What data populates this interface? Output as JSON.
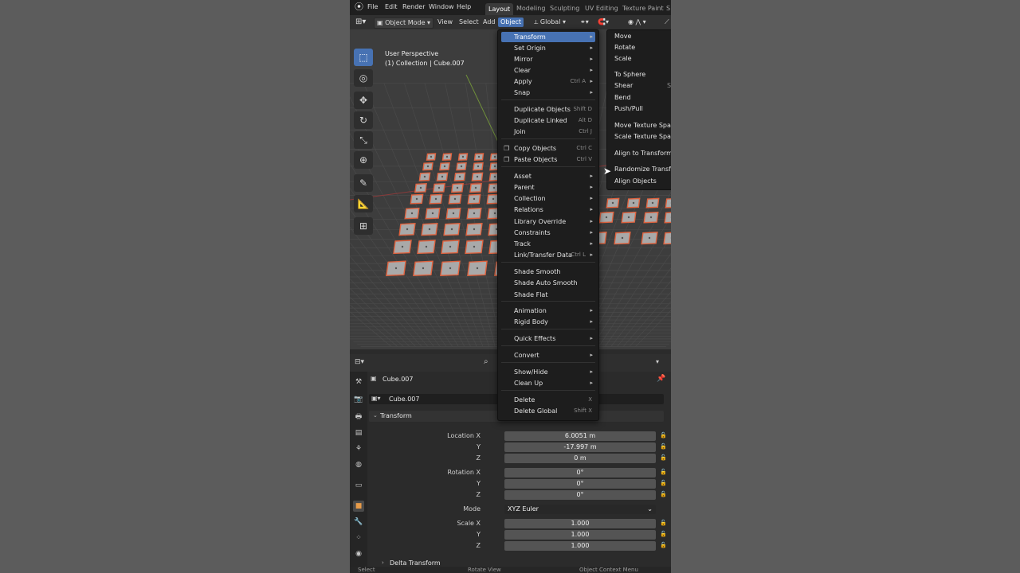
{
  "topbar": {
    "menus": [
      "File",
      "Edit",
      "Render",
      "Window",
      "Help"
    ],
    "workspaces": [
      "Layout",
      "Modeling",
      "Sculpting",
      "UV Editing",
      "Texture Paint",
      "S"
    ]
  },
  "header": {
    "mode": "Object Mode",
    "view": "View",
    "select": "Select",
    "add": "Add",
    "object": "Object",
    "orientation": "Global"
  },
  "viewport": {
    "perspective": "User Perspective",
    "collection": "(1) Collection | Cube.007"
  },
  "context_menu": {
    "items": [
      {
        "label": "Transform",
        "shortcut": "",
        "submenu": true,
        "highlight": true
      },
      {
        "label": "Set Origin",
        "shortcut": "",
        "submenu": true
      },
      {
        "label": "Mirror",
        "shortcut": "",
        "submenu": true
      },
      {
        "label": "Clear",
        "shortcut": "",
        "submenu": true
      },
      {
        "label": "Apply",
        "shortcut": "Ctrl A",
        "submenu": true
      },
      {
        "label": "Snap",
        "shortcut": "",
        "submenu": true
      },
      {
        "label": "Duplicate Objects",
        "shortcut": "Shift D",
        "submenu": false
      },
      {
        "label": "Duplicate Linked",
        "shortcut": "Alt D",
        "submenu": false
      },
      {
        "label": "Join",
        "shortcut": "Ctrl J",
        "submenu": false
      },
      {
        "label": "Copy Objects",
        "shortcut": "Ctrl C",
        "submenu": false
      },
      {
        "label": "Paste Objects",
        "shortcut": "Ctrl V",
        "submenu": false
      },
      {
        "label": "Asset",
        "shortcut": "",
        "submenu": true
      },
      {
        "label": "Parent",
        "shortcut": "",
        "submenu": true
      },
      {
        "label": "Collection",
        "shortcut": "",
        "submenu": true
      },
      {
        "label": "Relations",
        "shortcut": "",
        "submenu": true
      },
      {
        "label": "Library Override",
        "shortcut": "",
        "submenu": true
      },
      {
        "label": "Constraints",
        "shortcut": "",
        "submenu": true
      },
      {
        "label": "Track",
        "shortcut": "",
        "submenu": true
      },
      {
        "label": "Link/Transfer Data",
        "shortcut": "Ctrl L",
        "submenu": true
      },
      {
        "label": "Shade Smooth",
        "shortcut": "",
        "submenu": false
      },
      {
        "label": "Shade Auto Smooth",
        "shortcut": "",
        "submenu": false
      },
      {
        "label": "Shade Flat",
        "shortcut": "",
        "submenu": false
      },
      {
        "label": "Animation",
        "shortcut": "",
        "submenu": true
      },
      {
        "label": "Rigid Body",
        "shortcut": "",
        "submenu": true
      },
      {
        "label": "Quick Effects",
        "shortcut": "",
        "submenu": true
      },
      {
        "label": "Convert",
        "shortcut": "",
        "submenu": true
      },
      {
        "label": "Show/Hide",
        "shortcut": "",
        "submenu": true
      },
      {
        "label": "Clean Up",
        "shortcut": "",
        "submenu": true
      },
      {
        "label": "Delete",
        "shortcut": "X",
        "submenu": false
      },
      {
        "label": "Delete Global",
        "shortcut": "Shift X",
        "submenu": false
      }
    ]
  },
  "transform_submenu": {
    "items": [
      "Move",
      "Rotate",
      "Scale",
      "To Sphere",
      "Shear",
      "Bend",
      "Push/Pull",
      "Move Texture Space",
      "Scale Texture Space",
      "Align to Transform Ori",
      "Randomize Transform",
      "Align Objects"
    ],
    "shear_shortcut": "S"
  },
  "properties": {
    "object_name": "Cube.007",
    "data_name": "Cube.007",
    "panel_title": "Transform",
    "location": {
      "label": "Location X",
      "x": "6.0051 m",
      "y": "-17.997 m",
      "z": "0 m"
    },
    "rotation": {
      "label": "Rotation X",
      "x": "0°",
      "y": "0°",
      "z": "0°"
    },
    "mode": {
      "label": "Mode",
      "value": "XYZ Euler"
    },
    "scale": {
      "label": "Scale X",
      "x": "1.000",
      "y": "1.000",
      "z": "1.000"
    },
    "axis_y": "Y",
    "axis_z": "Z",
    "delta": "Delta Transform"
  },
  "status_bar": {
    "left": "Select",
    "middle": "Rotate View",
    "right": "Object Context Menu"
  },
  "colors": {
    "accent": "#4772b3",
    "selection_outline": "#e0633f",
    "background": "#5c5c5c"
  }
}
